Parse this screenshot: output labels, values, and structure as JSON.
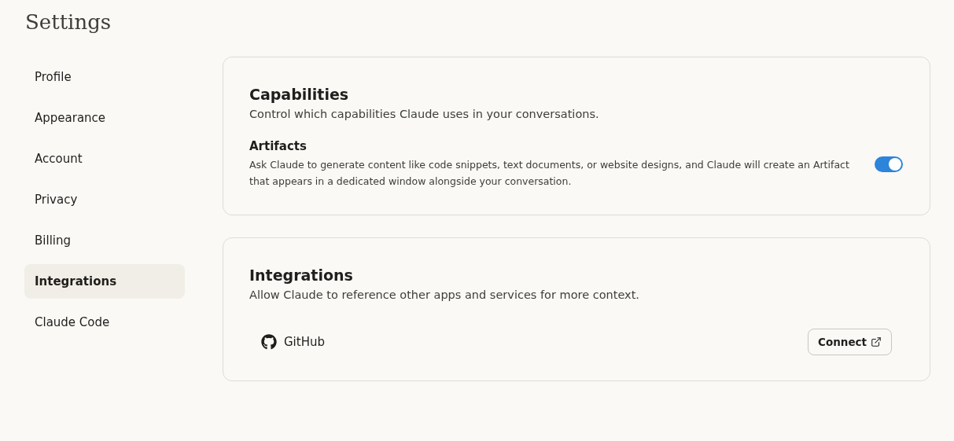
{
  "title": "Settings",
  "sidebar": {
    "items": [
      {
        "label": "Profile",
        "selected": false
      },
      {
        "label": "Appearance",
        "selected": false
      },
      {
        "label": "Account",
        "selected": false
      },
      {
        "label": "Privacy",
        "selected": false
      },
      {
        "label": "Billing",
        "selected": false
      },
      {
        "label": "Integrations",
        "selected": true
      },
      {
        "label": "Claude Code",
        "selected": false
      }
    ]
  },
  "capabilities": {
    "title": "Capabilities",
    "description": "Control which capabilities Claude uses in your conversations.",
    "settings": [
      {
        "title": "Artifacts",
        "description": "Ask Claude to generate content like code snippets, text documents, or website designs, and Claude will create an Artifact that appears in a dedicated window alongside your conversation.",
        "on": true
      }
    ]
  },
  "integrations": {
    "title": "Integrations",
    "description": "Allow Claude to reference other apps and services for more context.",
    "items": [
      {
        "name": "GitHub",
        "button": "Connect"
      }
    ]
  }
}
